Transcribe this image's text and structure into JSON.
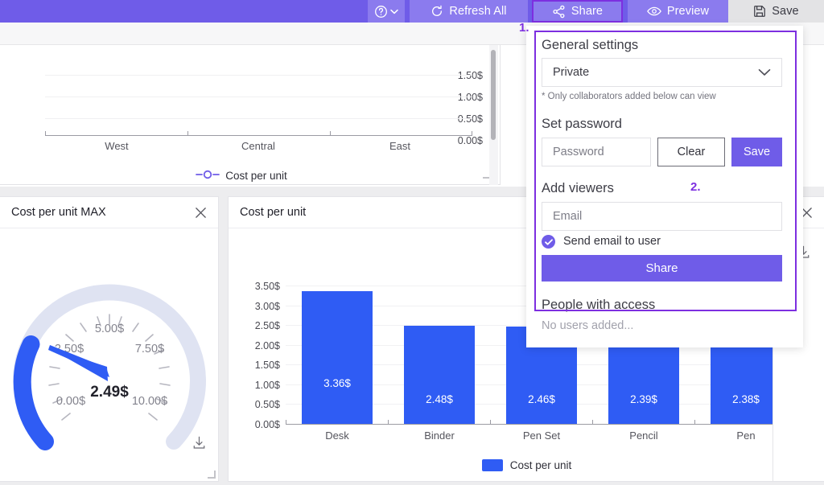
{
  "toolbar": {
    "help_label": "",
    "refresh_label": "Refresh All",
    "share_label": "Share",
    "preview_label": "Preview",
    "save_label": "Save",
    "bg_color": "#6f5ce8",
    "button_color": "#8b7bee",
    "highlight_color": "#7d2fe0"
  },
  "annotations": {
    "step1": "1.",
    "step2": "2."
  },
  "top_card": {
    "legend_label": "Cost per unit"
  },
  "gauge_card": {
    "title": "Cost per unit MAX",
    "close_icon": "close-icon",
    "download_icon": "download-icon",
    "value_label": "2.49$"
  },
  "bar_card": {
    "title": "Cost per unit",
    "legend_label": "Cost per unit"
  },
  "right_card": {
    "close_icon": "close-icon",
    "download_icon": "download-icon"
  },
  "share_panel": {
    "general_settings_title": "General settings",
    "visibility_value": "Private",
    "visibility_note": "* Only collaborators added below can view",
    "set_password_title": "Set password",
    "password_placeholder": "Password",
    "clear_label": "Clear",
    "save_label": "Save",
    "add_viewers_title": "Add viewers",
    "email_placeholder": "Email",
    "send_email_label": "Send email to user",
    "send_email_checked": true,
    "share_label": "Share",
    "people_with_access_title": "People with access",
    "no_users_label": "No users added..."
  },
  "chart_data": [
    {
      "type": "line",
      "title": "Cost per unit",
      "categories": [
        "West",
        "Central",
        "East"
      ],
      "series": [
        {
          "name": "Cost per unit",
          "values": [
            null,
            null,
            null
          ]
        }
      ],
      "ytick_labels": [
        "1.50$",
        "1.00$",
        "0.50$",
        "0.00$"
      ],
      "ytick_values": [
        1.5,
        1.0,
        0.5,
        0.0
      ],
      "ylim": [
        0,
        1.5
      ],
      "xlabel": "",
      "ylabel": "",
      "grid": true,
      "legend": "bottom-center",
      "note": "chart body scrolled out of view; only lower axis visible",
      "color": "#6f5ce8"
    },
    {
      "type": "gauge",
      "title": "Cost per unit MAX",
      "value": 2.49,
      "value_label": "2.49$",
      "min": 0,
      "max": 10,
      "tick_labels": [
        "0.00$",
        "2.50$",
        "5.00$",
        "7.50$",
        "10.00$"
      ],
      "tick_values": [
        0,
        2.5,
        5,
        7.5,
        10
      ],
      "arc_color": "#2f5cf4",
      "track_color": "#dfe3f2"
    },
    {
      "type": "bar",
      "title": "Cost per unit",
      "categories": [
        "Desk",
        "Binder",
        "Pen Set",
        "Pencil",
        "Pen"
      ],
      "values": [
        3.36,
        2.48,
        2.46,
        2.39,
        2.38
      ],
      "value_labels": [
        "3.36$",
        "2.48$",
        "2.46$",
        "2.39$",
        "2.38$"
      ],
      "ytick_labels": [
        "0.00$",
        "0.50$",
        "1.00$",
        "1.50$",
        "2.00$",
        "2.50$",
        "3.00$",
        "3.50$"
      ],
      "ytick_values": [
        0,
        0.5,
        1,
        1.5,
        2,
        2.5,
        3,
        3.5
      ],
      "ylim": [
        0,
        3.5
      ],
      "xlabel": "",
      "ylabel": "",
      "grid": true,
      "legend": "bottom-center",
      "legend_entries": [
        "Cost per unit"
      ],
      "color": "#2f5cf4"
    }
  ]
}
